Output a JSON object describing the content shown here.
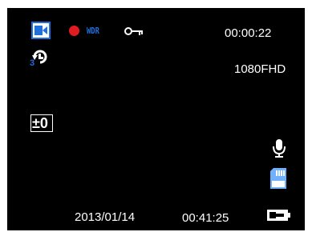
{
  "status_bar": {
    "mode_icon": "video-camera-icon",
    "recording_icon": "record-dot-icon",
    "recording_color": "#e11b22",
    "wdr_label": "WDR",
    "wdr_color": "#1e6fe0",
    "lock_icon": "key-icon",
    "timer": "00:00:22"
  },
  "loop_icon": "loop-recording-icon",
  "loop_minutes": "3",
  "resolution": "1080FHD",
  "exposure_label": "±0",
  "right_icons": {
    "mic": "microphone-icon",
    "sd": "sd-card-icon",
    "power": "power-plug-icon"
  },
  "footer": {
    "date": "2013/01/14",
    "time": "00:41:25"
  },
  "colors": {
    "background": "#000000",
    "text": "#ffffff",
    "accent_blue": "#1e6fe0",
    "sd_blue": "#6fb1ff"
  }
}
